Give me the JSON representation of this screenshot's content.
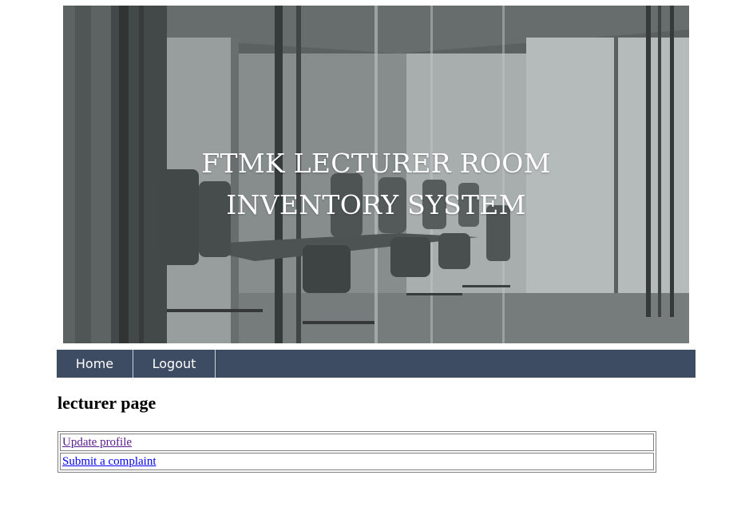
{
  "banner": {
    "title_line1": "FTMK LECTURER ROOM",
    "title_line2": "INVENTORY SYSTEM"
  },
  "nav": {
    "items": [
      {
        "label": "Home"
      },
      {
        "label": "Logout"
      }
    ],
    "background_color": "#3d4b63"
  },
  "main": {
    "heading": "lecturer page",
    "links": [
      {
        "label": "Update profile",
        "state": "visited",
        "color": "#551a8b"
      },
      {
        "label": "Submit a complaint",
        "state": "unvisited",
        "color": "#0000ee"
      }
    ]
  }
}
